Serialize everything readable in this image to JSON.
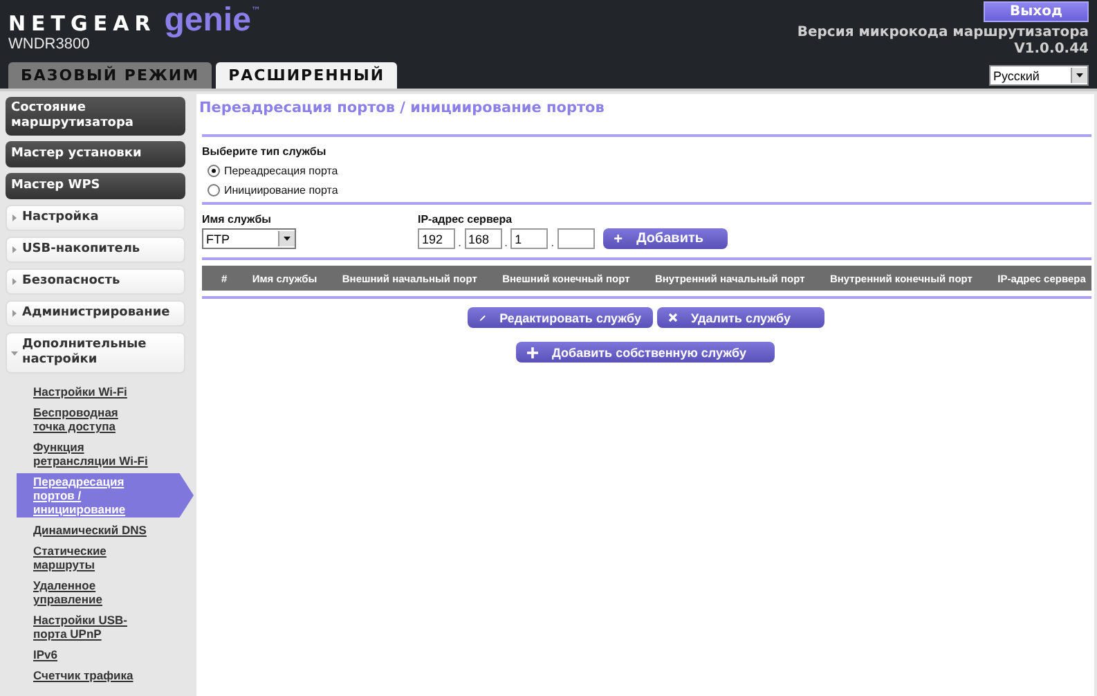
{
  "header": {
    "brand": "NETGEAR",
    "product": "genie",
    "trademark": "™",
    "model": "WNDR3800",
    "logout": "Выход",
    "firmware_label": "Версия микрокода маршрутизатора",
    "firmware_version": "V1.0.0.44",
    "language": "Русский"
  },
  "tabs": [
    {
      "label": "БАЗОВЫЙ РЕЖИМ",
      "selected": false
    },
    {
      "label": "РАСШИРЕННЫЙ",
      "selected": true
    }
  ],
  "sidebar": {
    "items": [
      {
        "label": "Состояние маршрутизатора",
        "kind": "dark"
      },
      {
        "label": "Мастер установки",
        "kind": "dark"
      },
      {
        "label": "Мастер WPS",
        "kind": "dark"
      },
      {
        "label": "Настройка",
        "kind": "group",
        "expanded": false
      },
      {
        "label": "USB-накопитель",
        "kind": "group",
        "expanded": false
      },
      {
        "label": "Безопасность",
        "kind": "group",
        "expanded": false
      },
      {
        "label": "Администрирование",
        "kind": "group",
        "expanded": false
      },
      {
        "label": "Дополнительные настройки",
        "kind": "group",
        "expanded": true,
        "children": [
          {
            "label": "Настройки Wi-Fi",
            "selected": false
          },
          {
            "label": "Беспроводная точка доступа",
            "selected": false
          },
          {
            "label": "Функция ретрансляции Wi-Fi",
            "selected": false
          },
          {
            "label": "Переадресация портов / инициирование",
            "selected": true
          },
          {
            "label": "Динамический DNS",
            "selected": false
          },
          {
            "label": "Статические маршруты",
            "selected": false
          },
          {
            "label": "Удаленное управление",
            "selected": false
          },
          {
            "label": "Настройки USB-порта UPnP",
            "selected": false
          },
          {
            "label": "IPv6",
            "selected": false
          },
          {
            "label": "Счетчик трафика",
            "selected": false
          }
        ]
      }
    ]
  },
  "page": {
    "title": "Переадресация портов / инициирование портов",
    "service_type": {
      "label": "Выберите тип службы",
      "options": [
        {
          "label": "Переадресация порта",
          "selected": true
        },
        {
          "label": "Инициирование порта",
          "selected": false
        }
      ]
    },
    "service_name": {
      "label": "Имя службы",
      "value": "FTP"
    },
    "server_ip": {
      "label": "IP-адрес сервера",
      "octets": [
        {
          "value": "192"
        },
        {
          "value": "168"
        },
        {
          "value": "1"
        },
        {
          "kind": "blank"
        }
      ],
      "separator": ".",
      "add_icon": "+",
      "add_button": "Добавить"
    },
    "table": {
      "columns": [
        "#",
        "Имя службы",
        "Внешний начальный порт",
        "Внешний конечный порт",
        "Внутренний начальный порт",
        "Внутренний конечный порт",
        "IP-адрес сервера"
      ]
    },
    "buttons": [
      {
        "label": "Редактировать службу",
        "kind": "edit"
      },
      {
        "label": "Удалить службу",
        "kind": "delete"
      },
      {
        "label": "Добавить собственную службу",
        "kind": "add"
      }
    ]
  }
}
